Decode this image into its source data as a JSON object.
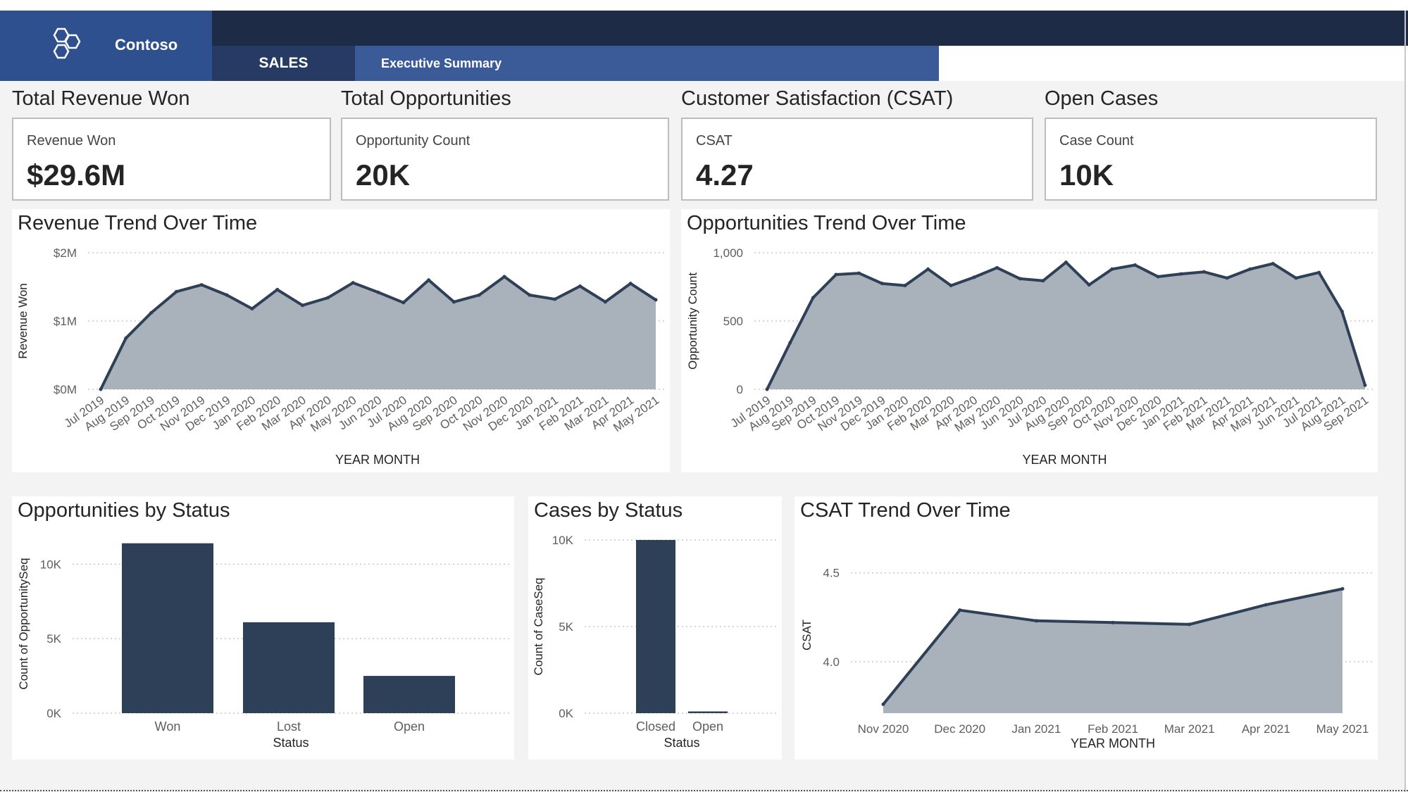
{
  "brand": {
    "name": "Contoso",
    "logo_icon": "hexagon-cluster-icon"
  },
  "nav": {
    "section": "SALES",
    "page": "Executive Summary"
  },
  "colors": {
    "header_dark": "#1d2b47",
    "header_nav": "#3b5a98",
    "brand_bg": "#2f508f",
    "series_line": "#2e4057",
    "series_fill": "#a9b1ba",
    "bar": "#2e4057"
  },
  "kpis": [
    {
      "title": "Total Revenue Won",
      "label": "Revenue Won",
      "value": "$29.6M"
    },
    {
      "title": "Total Opportunities",
      "label": "Opportunity Count",
      "value": "20K"
    },
    {
      "title": "Customer Satisfaction (CSAT)",
      "label": "CSAT",
      "value": "4.27"
    },
    {
      "title": "Open Cases",
      "label": "Case Count",
      "value": "10K"
    }
  ],
  "panels": {
    "revenue": "Revenue Trend Over Time",
    "opps": "Opportunities Trend Over Time",
    "opp_status": "Opportunities by Status",
    "cases": "Cases by Status",
    "csat": "CSAT Trend Over Time"
  },
  "chart_data": [
    {
      "id": "revenue",
      "type": "area",
      "xlabel": "YEAR MONTH",
      "ylabel": "Revenue Won",
      "categories": [
        "Jul 2019",
        "Aug 2019",
        "Sep 2019",
        "Oct 2019",
        "Nov 2019",
        "Dec 2019",
        "Jan 2020",
        "Feb 2020",
        "Mar 2020",
        "Apr 2020",
        "May 2020",
        "Jun 2020",
        "Jul 2020",
        "Aug 2020",
        "Sep 2020",
        "Oct 2020",
        "Nov 2020",
        "Dec 2020",
        "Jan 2021",
        "Feb 2021",
        "Mar 2021",
        "Apr 2021",
        "May 2021"
      ],
      "values": [
        0,
        0.75,
        1.12,
        1.43,
        1.53,
        1.38,
        1.18,
        1.46,
        1.23,
        1.34,
        1.56,
        1.42,
        1.27,
        1.6,
        1.28,
        1.38,
        1.65,
        1.38,
        1.32,
        1.51,
        1.28,
        1.55,
        1.31
      ],
      "y_ticks": [
        "$0M",
        "$1M",
        "$2M"
      ],
      "ylim": [
        0,
        2
      ],
      "grid": true
    },
    {
      "id": "opps",
      "type": "area",
      "xlabel": "YEAR MONTH",
      "ylabel": "Opportunity Count",
      "categories": [
        "Jul 2019",
        "Aug 2019",
        "Sep 2019",
        "Oct 2019",
        "Nov 2019",
        "Dec 2019",
        "Jan 2020",
        "Feb 2020",
        "Mar 2020",
        "Apr 2020",
        "May 2020",
        "Jun 2020",
        "Jul 2020",
        "Aug 2020",
        "Sep 2020",
        "Oct 2020",
        "Nov 2020",
        "Dec 2020",
        "Jan 2021",
        "Feb 2021",
        "Mar 2021",
        "Apr 2021",
        "May 2021",
        "Jun 2021",
        "Jul 2021",
        "Aug 2021",
        "Sep 2021"
      ],
      "values": [
        0,
        340,
        670,
        840,
        850,
        775,
        760,
        880,
        760,
        820,
        890,
        810,
        795,
        930,
        765,
        880,
        910,
        825,
        845,
        860,
        815,
        880,
        920,
        815,
        855,
        570,
        30
      ],
      "y_ticks": [
        "0",
        "500",
        "1,000"
      ],
      "ylim": [
        0,
        1000
      ],
      "grid": true
    },
    {
      "id": "opp_status",
      "type": "bar",
      "xlabel": "Status",
      "ylabel": "Count of OpportunitySeq",
      "categories": [
        "Won",
        "Lost",
        "Open"
      ],
      "values": [
        11400,
        6100,
        2500
      ],
      "y_ticks": [
        "0K",
        "5K",
        "10K"
      ],
      "ylim": [
        0,
        12000
      ],
      "grid": true
    },
    {
      "id": "cases",
      "type": "bar",
      "xlabel": "Status",
      "ylabel": "Count of CaseSeq",
      "categories": [
        "Closed",
        "Open"
      ],
      "values": [
        10000,
        100
      ],
      "y_ticks": [
        "0K",
        "5K",
        "10K"
      ],
      "ylim": [
        0,
        10000
      ],
      "grid": true
    },
    {
      "id": "csat",
      "type": "area",
      "xlabel": "YEAR MONTH",
      "ylabel": "CSAT",
      "categories": [
        "Nov 2020",
        "Dec 2020",
        "Jan 2021",
        "Feb 2021",
        "Mar 2021",
        "Apr 2021",
        "May 2021"
      ],
      "values": [
        3.76,
        4.29,
        4.23,
        4.22,
        4.21,
        4.32,
        4.41
      ],
      "y_ticks": [
        "4.0",
        "4.5"
      ],
      "y_tick_values": [
        4.0,
        4.5
      ],
      "ylim": [
        3.71,
        4.59
      ],
      "grid": true
    }
  ]
}
